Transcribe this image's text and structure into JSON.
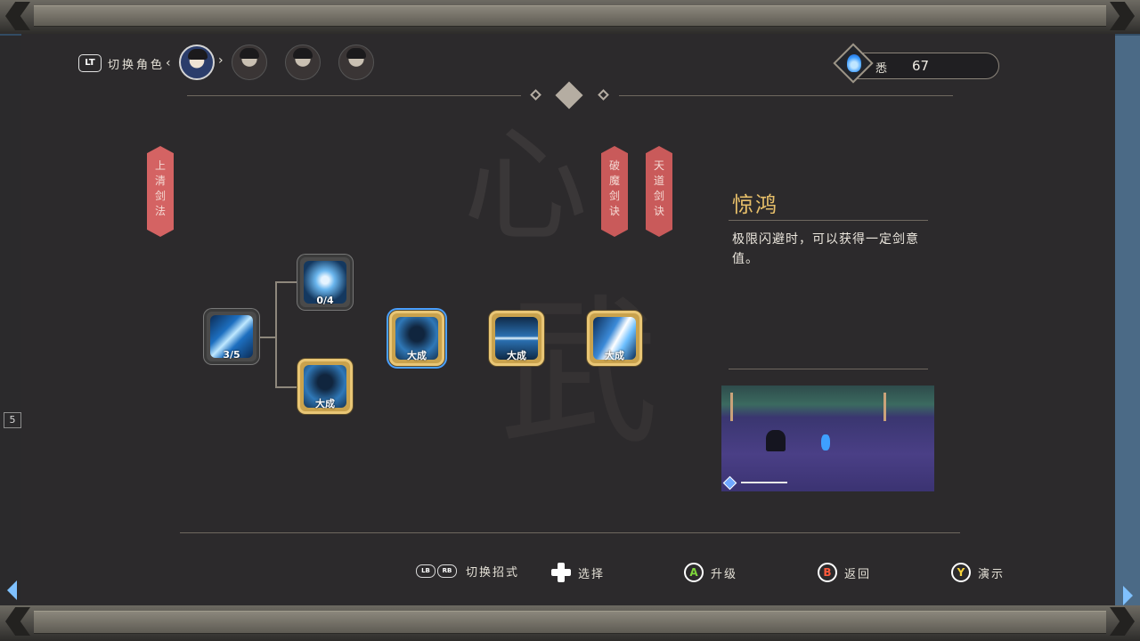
{
  "header": {
    "switch_button": "LT",
    "switch_label": "切换角色",
    "characters": [
      "character-1",
      "character-2",
      "character-3",
      "character-4"
    ],
    "currency_label": "悉",
    "currency_value": "67"
  },
  "banners": [
    "上\n清\n剑\n法",
    "破\n魔\n剑\n诀",
    "天\n道\n剑\n诀"
  ],
  "skills": [
    {
      "name": "skill-root",
      "level": "3/5"
    },
    {
      "name": "skill-upper",
      "level": "0/4"
    },
    {
      "name": "skill-lower",
      "level": "大成"
    },
    {
      "name": "skill-jinghong",
      "level": "大成"
    },
    {
      "name": "skill-sword",
      "level": "大成"
    },
    {
      "name": "skill-slash",
      "level": "大成"
    }
  ],
  "detail": {
    "name": "惊鸿",
    "description": "极限闪避时，可以获得一定剑意值。"
  },
  "footer": {
    "lb": "LB",
    "rb": "RB",
    "switch_move": "切换招式",
    "select": "选择",
    "a_key": "A",
    "upgrade": "升级",
    "b_key": "B",
    "back": "返回",
    "y_key": "Y",
    "demo": "演示"
  },
  "colors": {
    "gold": "#e8c06a",
    "banner": "#d46363",
    "panel": "#2c2a2c"
  }
}
